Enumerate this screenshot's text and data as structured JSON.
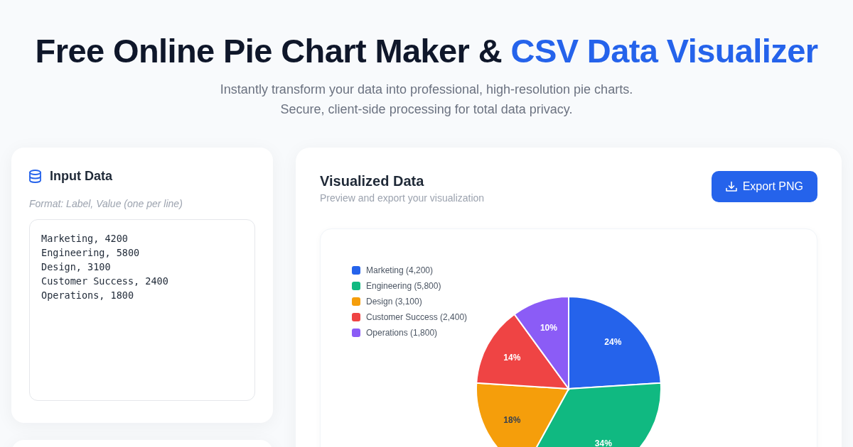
{
  "header": {
    "title": [
      {
        "text": "Free Online Pie Chart Maker &",
        "accent": false
      },
      {
        "text": "CSV Data Visualizer",
        "accent": true
      }
    ],
    "subtitle_lines": [
      "Instantly transform your data into professional, high-resolution pie charts.",
      "Secure, client-side processing for total data privacy."
    ]
  },
  "input_panel": {
    "title": "Input Data",
    "hint": "Format: Label, Value (one per line)",
    "value": "Marketing, 4200\nEngineering, 5800\nDesign, 3100\nCustomer Success, 2400\nOperations, 1800"
  },
  "visualization": {
    "title": "Visualized Data",
    "subtitle": "Preview and export your visualization",
    "export_button": "Export PNG",
    "legend": [
      {
        "label": "Marketing (4,200)",
        "color": "#2563eb"
      },
      {
        "label": "Engineering (5,800)",
        "color": "#10b981"
      },
      {
        "label": "Design (3,100)",
        "color": "#f59e0b"
      },
      {
        "label": "Customer Success (2,400)",
        "color": "#ef4444"
      },
      {
        "label": "Operations (1,800)",
        "color": "#8b5cf6"
      }
    ],
    "chart_data": {
      "type": "pie",
      "values": [
        24,
        34,
        18,
        14,
        10
      ],
      "value_labels": [
        "24%",
        "34%",
        "18%",
        "14%",
        "10%"
      ]
    }
  }
}
